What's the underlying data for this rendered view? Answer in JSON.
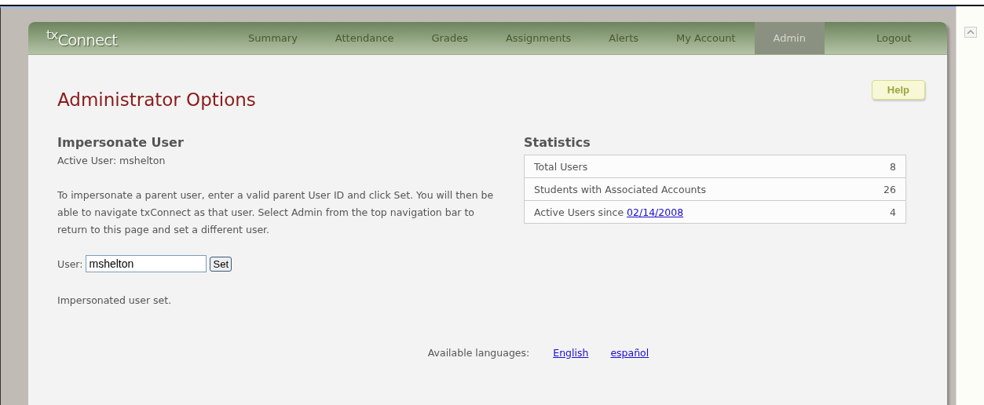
{
  "logo": "$^{tx}$Connect",
  "nav": [
    {
      "label": "Summary",
      "selected": false
    },
    {
      "label": "Attendance",
      "selected": false
    },
    {
      "label": "Grades",
      "selected": false
    },
    {
      "label": "Assignments",
      "selected": false
    },
    {
      "label": "Alerts",
      "selected": false
    },
    {
      "label": "My Account",
      "selected": false
    },
    {
      "label": "Admin",
      "selected": true
    },
    {
      "label": "Logout",
      "selected": false
    }
  ],
  "title": "Administrator Options",
  "help": "Help",
  "impersonate": {
    "heading": "Impersonate User",
    "active_user": "Active User: mshelton",
    "instructions": "To impersonate a parent user, enter a valid parent User ID and click Set. You will then be able to navigate txConnect as that user. Select Admin from the top navigation bar to return to this page and set a different user.",
    "field_label": "User:",
    "value": "mshelton",
    "button": "Set",
    "message": "Impersonated user set."
  },
  "statistics": {
    "heading": "Statistics",
    "rows": [
      {
        "label": "Total Users",
        "value": "8"
      },
      {
        "label": "Students with Associated Accounts",
        "value": "26"
      },
      {
        "label": "Active Users since",
        "link": "02/14/2008",
        "value": "4"
      }
    ]
  },
  "languages": {
    "label": "Available languages:",
    "links": [
      "English",
      "español"
    ]
  }
}
